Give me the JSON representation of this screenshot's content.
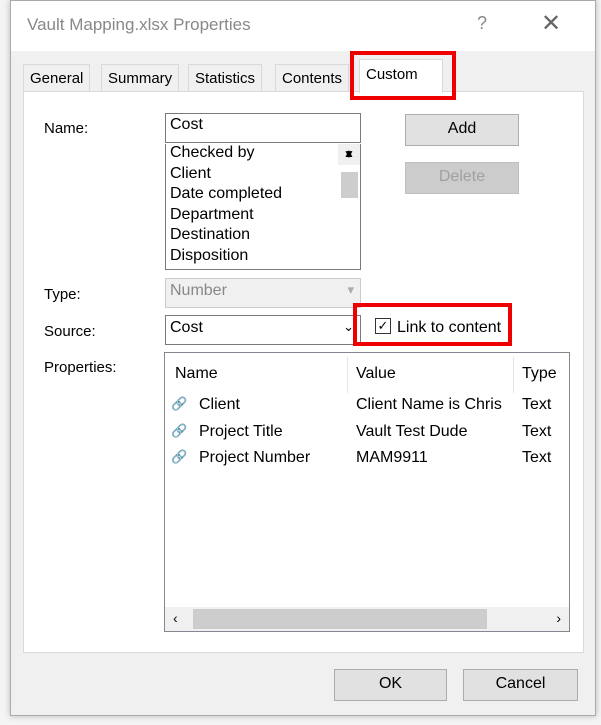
{
  "dialog": {
    "title": "Vault Mapping.xlsx Properties",
    "help": "?",
    "close": "✕"
  },
  "tabs": [
    {
      "label": "General"
    },
    {
      "label": "Summary"
    },
    {
      "label": "Statistics"
    },
    {
      "label": "Contents"
    },
    {
      "label": "Custom",
      "active": true
    }
  ],
  "form": {
    "name_label": "Name:",
    "name_value": "Cost",
    "name_list": [
      "Checked by",
      "Client",
      "Date completed",
      "Department",
      "Destination",
      "Disposition"
    ],
    "add_label": "Add",
    "delete_label": "Delete",
    "type_label": "Type:",
    "type_value": "Number",
    "source_label": "Source:",
    "source_value": "Cost",
    "link_label": "Link to content",
    "link_checked": true,
    "properties_label": "Properties:"
  },
  "properties": {
    "columns": [
      "Name",
      "Value",
      "Type"
    ],
    "rows": [
      {
        "name": "Client",
        "value": "Client Name is Chris",
        "type": "Text"
      },
      {
        "name": "Project Title",
        "value": "Vault Test Dude",
        "type": "Text"
      },
      {
        "name": "Project Number",
        "value": "MAM9911",
        "type": "Text"
      }
    ]
  },
  "footer": {
    "ok": "OK",
    "cancel": "Cancel"
  },
  "highlight_color": "#ee0000"
}
